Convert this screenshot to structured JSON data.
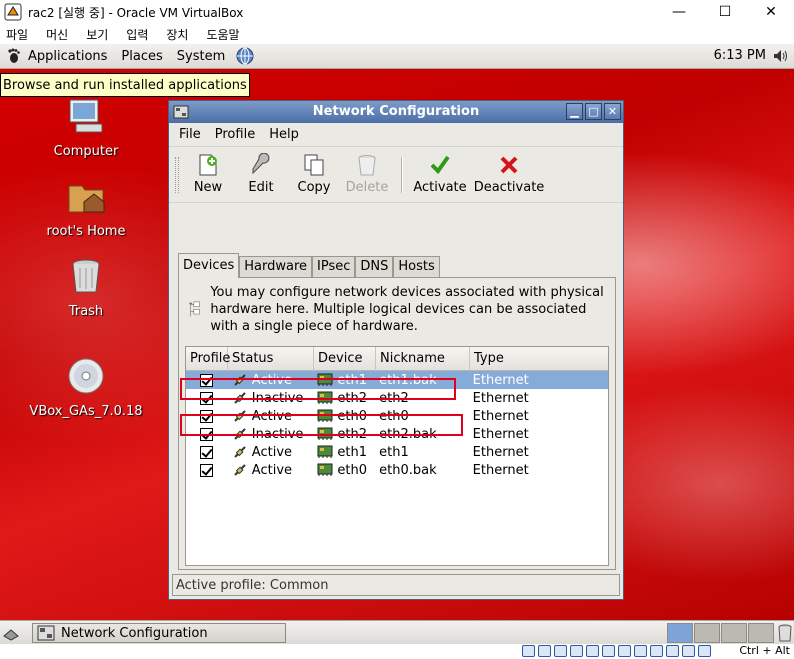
{
  "host": {
    "title": "rac2 [실행 중] - Oracle VM VirtualBox",
    "controls": [
      "—",
      "☐",
      "✕"
    ],
    "menu": [
      "파일",
      "머신",
      "보기",
      "입력",
      "장치",
      "도움말"
    ],
    "hostkey": "Ctrl + Alt"
  },
  "top_panel": {
    "menus": [
      "Applications",
      "Places",
      "System"
    ],
    "clock": "6:13 PM",
    "tooltip": "Browse and run installed applications"
  },
  "desktop_icons": [
    {
      "label": "Computer",
      "icon": "computer-icon"
    },
    {
      "label": "root's Home",
      "icon": "home-folder-icon"
    },
    {
      "label": "Trash",
      "icon": "trash-icon"
    },
    {
      "label": "VBox_GAs_7.0.18",
      "icon": "cdrom-icon"
    }
  ],
  "window": {
    "title": "Network Configuration",
    "menu": {
      "file": "File",
      "profile": "Profile",
      "help": "Help"
    },
    "toolbar": {
      "new": "New",
      "edit": "Edit",
      "copy": "Copy",
      "delete": "Delete",
      "activate": "Activate",
      "deactivate": "Deactivate"
    },
    "tabs": [
      "Devices",
      "Hardware",
      "IPsec",
      "DNS",
      "Hosts"
    ],
    "info_text": "You may configure network devices associated with physical hardware here.  Multiple logical devices can be associated with a single piece of hardware.",
    "columns": {
      "profile": "Profile",
      "status": "Status",
      "device": "Device",
      "nickname": "Nickname",
      "type": "Type"
    },
    "devices": [
      {
        "status": "Active",
        "device": "eth1",
        "nickname": "eth1.bak",
        "type": "Ethernet",
        "checked": true,
        "selected": true
      },
      {
        "status": "Inactive",
        "device": "eth2",
        "nickname": "eth2",
        "type": "Ethernet",
        "checked": true,
        "selected": false
      },
      {
        "status": "Active",
        "device": "eth0",
        "nickname": "eth0",
        "type": "Ethernet",
        "checked": true,
        "selected": false
      },
      {
        "status": "Inactive",
        "device": "eth2",
        "nickname": "eth2.bak",
        "type": "Ethernet",
        "checked": true,
        "selected": false
      },
      {
        "status": "Active",
        "device": "eth1",
        "nickname": "eth1",
        "type": "Ethernet",
        "checked": true,
        "selected": false
      },
      {
        "status": "Active",
        "device": "eth0",
        "nickname": "eth0.bak",
        "type": "Ethernet",
        "checked": true,
        "selected": false
      }
    ],
    "status_bar": "Active profile: Common"
  },
  "taskbar": {
    "task": "Network Configuration"
  },
  "colors": {
    "highlight_box": "#e0001b",
    "selected_row": "#86abd9",
    "titlebar": "#4b6fa6"
  }
}
